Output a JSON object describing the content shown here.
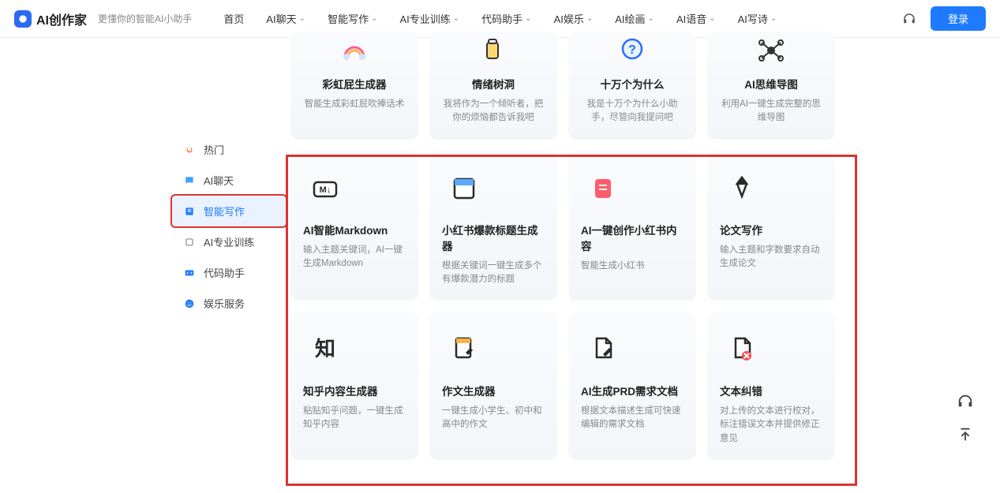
{
  "header": {
    "brand": "AI创作家",
    "slogan": "更懂你的智能AI小助手",
    "nav": [
      {
        "label": "首页",
        "dropdown": false
      },
      {
        "label": "AI聊天",
        "dropdown": true
      },
      {
        "label": "智能写作",
        "dropdown": true
      },
      {
        "label": "AI专业训练",
        "dropdown": true
      },
      {
        "label": "代码助手",
        "dropdown": true
      },
      {
        "label": "AI娱乐",
        "dropdown": true
      },
      {
        "label": "AI绘画",
        "dropdown": true
      },
      {
        "label": "AI语音",
        "dropdown": true
      },
      {
        "label": "AI写诗",
        "dropdown": true
      }
    ],
    "login": "登录"
  },
  "sidebar": {
    "items": [
      {
        "label": "热门",
        "icon": "fire"
      },
      {
        "label": "AI聊天",
        "icon": "chat"
      },
      {
        "label": "智能写作",
        "icon": "write",
        "active": true
      },
      {
        "label": "AI专业训练",
        "icon": "train"
      },
      {
        "label": "代码助手",
        "icon": "code"
      },
      {
        "label": "娱乐服务",
        "icon": "smile"
      }
    ]
  },
  "cards_row0": [
    {
      "title": "彩虹屁生成器",
      "desc": "智能生成彩虹屁吹捧话术",
      "icon": "rainbow"
    },
    {
      "title": "情绪树洞",
      "desc": "我将作为一个倾听者，把你的烦恼都告诉我吧",
      "icon": "cup"
    },
    {
      "title": "十万个为什么",
      "desc": "我是十万个为什么小助手，尽管向我提问吧",
      "icon": "question"
    },
    {
      "title": "AI思维导图",
      "desc": "利用AI一键生成完整的思维导图",
      "icon": "mindmap"
    }
  ],
  "cards_row1": [
    {
      "title": "AI智能Markdown",
      "desc": "输入主题关键词，AI一键生成Markdown",
      "icon": "markdown"
    },
    {
      "title": "小红书爆款标题生成器",
      "desc": "根据关键词一键生成多个有爆款潜力的标题",
      "icon": "window"
    },
    {
      "title": "AI一键创作小红书内容",
      "desc": "智能生成小红书",
      "icon": "note"
    },
    {
      "title": "论文写作",
      "desc": "输入主题和字数要求自动生成论文",
      "icon": "pen"
    }
  ],
  "cards_row2": [
    {
      "title": "知乎内容生成器",
      "desc": "粘贴知乎问题，一键生成知乎内容",
      "icon": "zhi"
    },
    {
      "title": "作文生成器",
      "desc": "一键生成小学生、初中和高中的作文",
      "icon": "doc-edit"
    },
    {
      "title": "AI生成PRD需求文档",
      "desc": "根据文本描述生成可快速编辑的需求文档",
      "icon": "doc-pen"
    },
    {
      "title": "文本纠错",
      "desc": "对上传的文本进行校对，标注错误文本并提供修正意见",
      "icon": "doc-x"
    }
  ]
}
